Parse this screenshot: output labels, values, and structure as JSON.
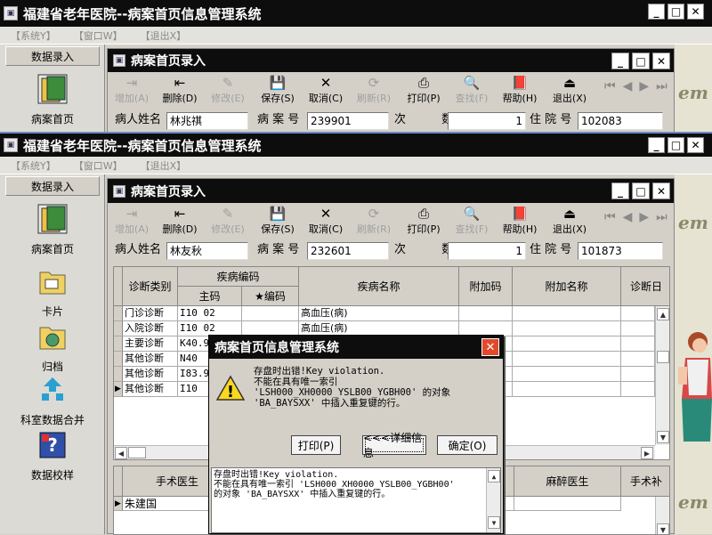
{
  "app": {
    "title": "福建省老年医院--病案首页信息管理系统"
  },
  "menu": [
    "【系统Y】",
    "【窗口W】",
    "【退出X】"
  ],
  "sidebar": {
    "header": "数据录入",
    "items": [
      "病案首页",
      "卡片",
      "归档",
      "科室数据合并",
      "数据校样"
    ]
  },
  "child": {
    "title": "病案首页录入"
  },
  "toolbar": [
    {
      "label": "增加(A)",
      "icon": "add-icon",
      "enabled": false
    },
    {
      "label": "删除(D)",
      "icon": "delete-icon",
      "enabled": true
    },
    {
      "label": "修改(E)",
      "icon": "edit-icon",
      "enabled": false
    },
    {
      "label": "保存(S)",
      "icon": "save-icon",
      "enabled": true
    },
    {
      "label": "取消(C)",
      "icon": "cancel-icon",
      "enabled": true
    },
    {
      "label": "刷新(R)",
      "icon": "refresh-icon",
      "enabled": false
    },
    {
      "label": "打印(P)",
      "icon": "print-icon",
      "enabled": true
    },
    {
      "label": "查找(F)",
      "icon": "find-icon",
      "enabled": false
    },
    {
      "label": "帮助(H)",
      "icon": "help-icon",
      "enabled": true
    },
    {
      "label": "退出(X)",
      "icon": "exit-icon",
      "enabled": true
    }
  ],
  "bg_record": {
    "name_label": "病人姓名",
    "name": "林兆祺",
    "case_label": "病 案 号",
    "case": "239901",
    "times_label": "次 数",
    "times": "1",
    "hosp_label": "住 院 号",
    "hosp": "102083"
  },
  "record": {
    "name_label": "病人姓名",
    "name": "林友秋",
    "case_label": "病 案 号",
    "case": "232601",
    "times_label": "次 数",
    "times": "1",
    "hosp_label": "住 院 号",
    "hosp": "101873"
  },
  "diag_grid": {
    "headers": {
      "type": "诊断类别",
      "code_group": "疾病编码",
      "main_code": "主码",
      "star_code": "★编码",
      "name": "疾病名称",
      "extra_code": "附加码",
      "extra_name": "附加名称",
      "date": "诊断日"
    },
    "rows": [
      {
        "type": "门诊诊断",
        "code": "I10  02",
        "name": "高血压(病)"
      },
      {
        "type": "入院诊断",
        "code": "I10  02",
        "name": "高血压(病)"
      },
      {
        "type": "主要诊断",
        "code": "K40.9",
        "name": ""
      },
      {
        "type": "其他诊断",
        "code": "N40",
        "name": ""
      },
      {
        "type": "其他诊断",
        "code": "I83.9",
        "name": ""
      },
      {
        "type": "其他诊断",
        "code": "I10",
        "name": ""
      }
    ]
  },
  "surgery_grid": {
    "headers": {
      "doctor": "手术医生",
      "anesthesia": "麻醉医生",
      "surgery": "手术补"
    },
    "rows": [
      {
        "doctor": "朱建国"
      }
    ]
  },
  "dialog": {
    "title": "病案首页信息管理系统",
    "message": [
      "存盘时出错!Key violation.",
      "不能在具有唯一索引",
      "'LSH000_XH0000_YSLB00_YGBH00' 的对象",
      "'BA_BAYSXX' 中插入重复键的行。"
    ],
    "buttons": {
      "print": "打印(P)",
      "details": "<<<详细信息",
      "ok": "确定(O)"
    },
    "detail_text": [
      "存盘时出错!Key violation.",
      "不能在具有唯一索引 'LSH000_XH0000_YSLB00_YGBH00'",
      "的对象 'BA_BAYSXX' 中插入重复键的行。"
    ]
  },
  "brand_fragment": "em"
}
